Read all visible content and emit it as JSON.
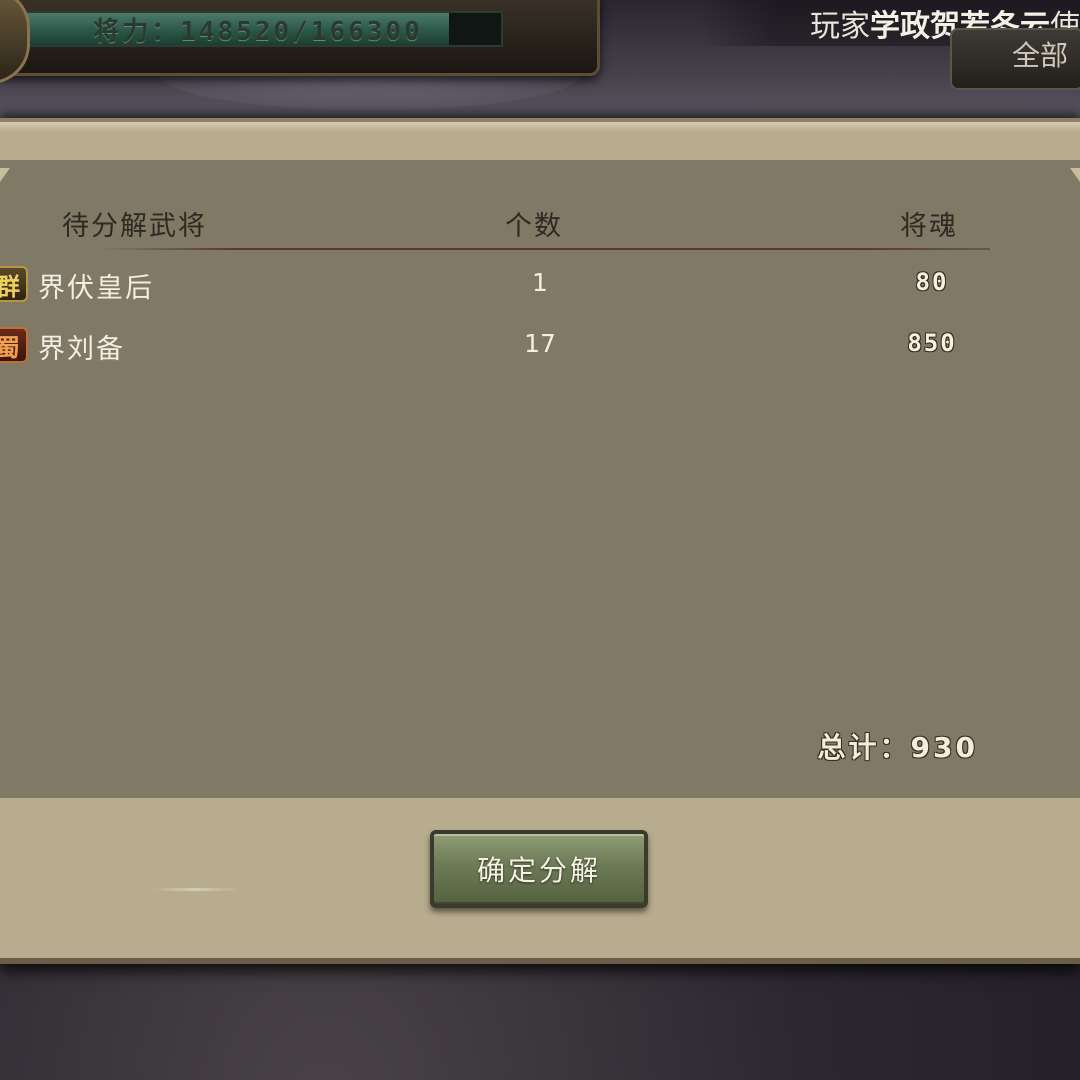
{
  "hud": {
    "power_text": "将力：148520/166300",
    "power_current": 148520,
    "power_max": 166300
  },
  "announcement": {
    "prefix": "玩家",
    "player_name": "学政贺若冬云",
    "suffix": "使"
  },
  "right_tab": {
    "label": "全部"
  },
  "dialog": {
    "columns": {
      "name": "待分解武将",
      "count": "个数",
      "soul": "将魂"
    },
    "rows": [
      {
        "faction": "群",
        "faction_color": "#f0d060",
        "name": "界伏皇后",
        "count": "1",
        "soul": "80"
      },
      {
        "faction": "蜀",
        "faction_color": "#f0a050",
        "name": "界刘备",
        "count": "17",
        "soul": "850"
      }
    ],
    "total_label": "总计：930",
    "confirm_label": "确定分解"
  },
  "colors": {
    "panel": "#807966",
    "dialog_border": "#b8ac8e",
    "button": "#6c7a56"
  }
}
